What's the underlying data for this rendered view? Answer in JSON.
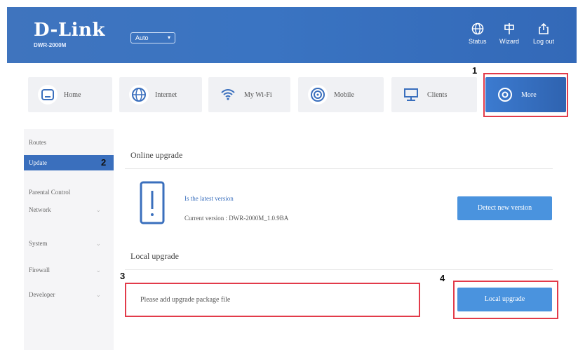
{
  "header": {
    "logo": "D-Link",
    "model": "DWR-2000M",
    "language": "Auto",
    "buttons": [
      {
        "label": "Status",
        "icon": "globe-icon"
      },
      {
        "label": "Wizard",
        "icon": "wizard-icon"
      },
      {
        "label": "Log out",
        "icon": "logout-icon"
      }
    ]
  },
  "tabs": [
    {
      "label": "Home",
      "icon": "home-icon"
    },
    {
      "label": "Internet",
      "icon": "internet-icon"
    },
    {
      "label": "My Wi-Fi",
      "icon": "wifi-icon"
    },
    {
      "label": "Mobile",
      "icon": "mobile-icon"
    },
    {
      "label": "Clients",
      "icon": "clients-icon"
    },
    {
      "label": "More",
      "icon": "more-icon"
    }
  ],
  "sidebar": {
    "items": [
      {
        "label": "Routes"
      },
      {
        "label": "Update"
      },
      {
        "label": "Parental Control"
      },
      {
        "label": "Network"
      },
      {
        "label": "System"
      },
      {
        "label": "Firewall"
      },
      {
        "label": "Developer"
      }
    ]
  },
  "online_upgrade": {
    "title": "Online upgrade",
    "status": "Is the latest version",
    "current_version": "Current version : DWR-2000M_1.0.9BA",
    "detect_button": "Detect new version"
  },
  "local_upgrade": {
    "title": "Local upgrade",
    "placeholder": "Please add upgrade package file",
    "button": "Local upgrade"
  },
  "callouts": [
    "1",
    "2",
    "3",
    "4"
  ],
  "colors": {
    "header": "#3a72c0",
    "accent": "#4a93de",
    "highlight": "#e23b4a",
    "active_nav": "#3a6fbd"
  }
}
